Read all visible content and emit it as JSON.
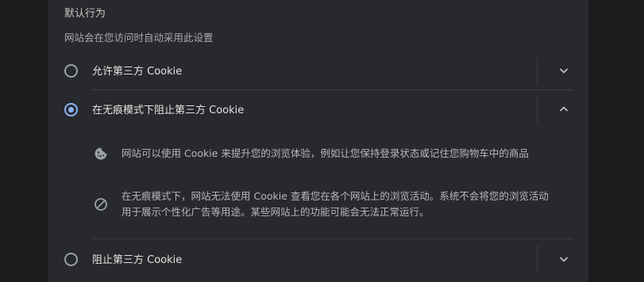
{
  "section": {
    "title": "默认行为",
    "subtitle": "网站会在您访问时自动采用此设置"
  },
  "options": [
    {
      "label": "允许第三方 Cookie",
      "selected": false,
      "expanded": false,
      "chevron_icon": "chevron-down-icon"
    },
    {
      "label": "在无痕模式下阻止第三方 Cookie",
      "selected": true,
      "expanded": true,
      "chevron_icon": "chevron-up-icon",
      "details": [
        {
          "icon": "cookie-icon",
          "text": "网站可以使用 Cookie 来提升您的浏览体验，例如让您保持登录状态或记住您购物车中的商品"
        },
        {
          "icon": "block-icon",
          "lines": [
            "在无痕模式下，网站无法使用 Cookie 查看您在各个网站上的浏览活动。系统不会将您的浏览活动",
            "用于展示个性化广告等用途。某些网站上的功能可能会无法正常运行。"
          ]
        }
      ]
    },
    {
      "label": "阻止第三方 Cookie",
      "selected": false,
      "expanded": false,
      "chevron_icon": "chevron-down-icon"
    }
  ],
  "colors": {
    "accent": "#8ab4f8",
    "card_background": "#28292c",
    "page_background": "#202124"
  }
}
